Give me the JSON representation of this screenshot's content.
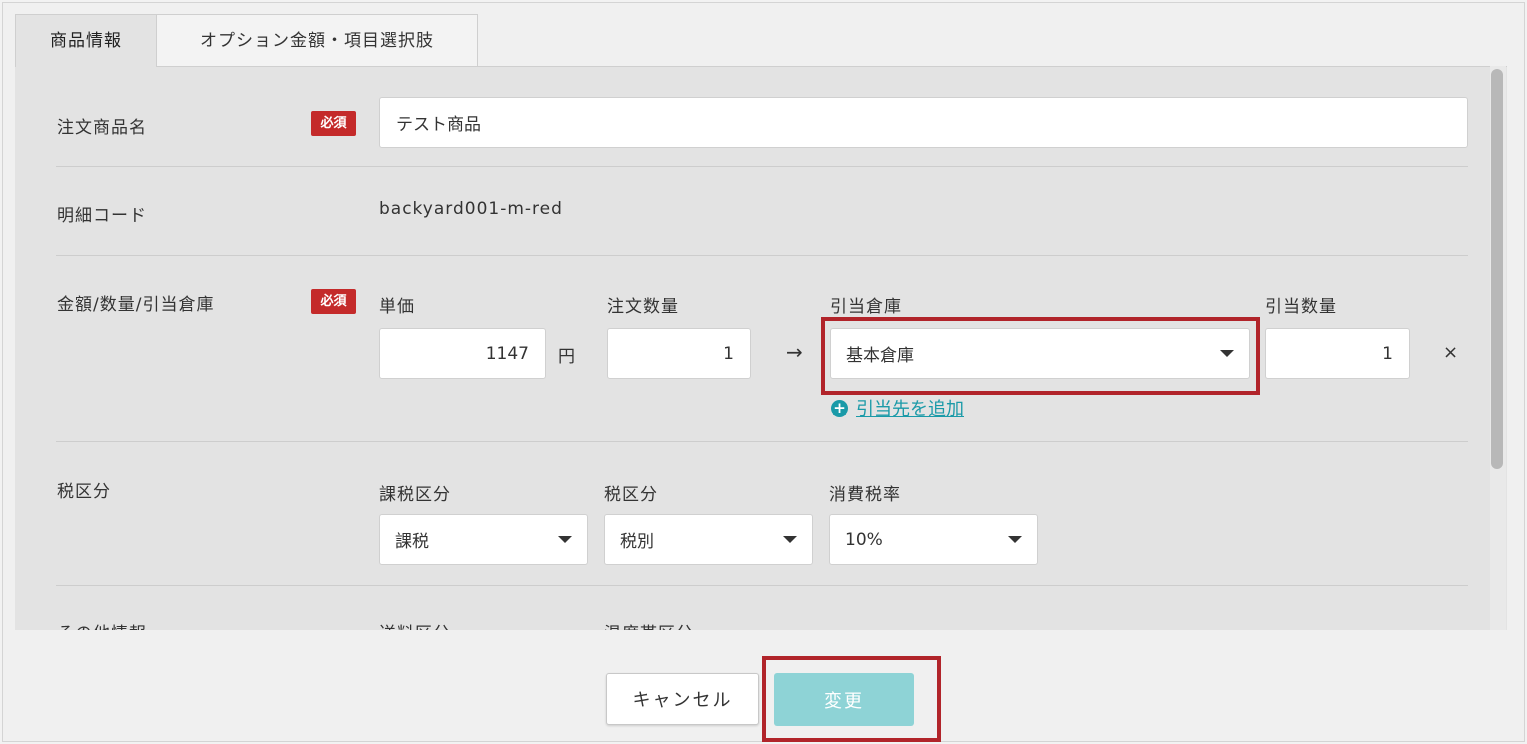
{
  "tabs": [
    {
      "label": "商品情報",
      "active": true
    },
    {
      "label": "オプション金額・項目選択肢",
      "active": false
    }
  ],
  "required_badge": "必須",
  "product_name": {
    "label": "注文商品名",
    "value": "テスト商品"
  },
  "detail_code": {
    "label": "明細コード",
    "value": "backyard001-m-red"
  },
  "amount_section": {
    "label": "金額/数量/引当倉庫",
    "unit_price_label": "単価",
    "unit_price_value": "1147",
    "currency_unit": "円",
    "order_qty_label": "注文数量",
    "order_qty_value": "1",
    "arrow": "→",
    "warehouse_label": "引当倉庫",
    "warehouse_value": "基本倉庫",
    "alloc_qty_label": "引当数量",
    "alloc_qty_value": "1",
    "remove_glyph": "×",
    "add_link_label": "引当先を追加"
  },
  "tax_section": {
    "label": "税区分",
    "taxable_label": "課税区分",
    "taxable_value": "課税",
    "tax_type_label": "税区分",
    "tax_type_value": "税別",
    "rate_label": "消費税率",
    "rate_value": "10%"
  },
  "other_section": {
    "label": "その他情報",
    "field1_label": "送料区分",
    "field2_label": "温度帯区分"
  },
  "buttons": {
    "cancel": "キャンセル",
    "submit": "変更"
  },
  "colors": {
    "required": "#c42a2a",
    "highlight": "#b1242a",
    "link": "#1a9aa8",
    "submit_disabled": "#8ed3d6"
  }
}
